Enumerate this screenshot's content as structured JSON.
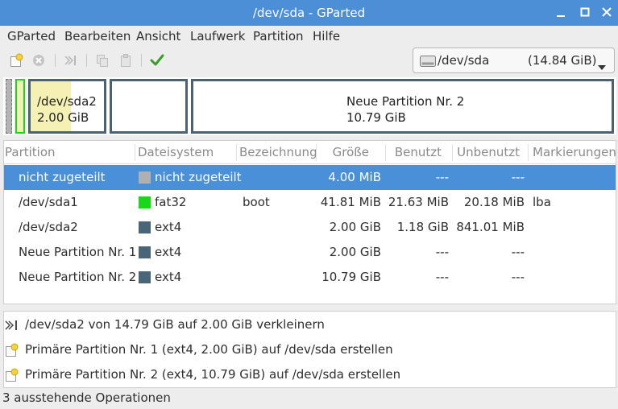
{
  "window": {
    "title": "/dev/sda - GParted"
  },
  "menu": [
    "GParted",
    "Bearbeiten",
    "Ansicht",
    "Laufwerk",
    "Partition",
    "Hilfe"
  ],
  "toolbar": {
    "icons": [
      "new-partition-icon",
      "delete-icon",
      "resize-move-icon",
      "copy-icon",
      "paste-icon",
      "apply-icon"
    ]
  },
  "device": {
    "name": "/dev/sda",
    "size": "(14.84 GiB)"
  },
  "graph": {
    "segments": [
      {
        "name": "/dev/sda2",
        "size": "2.00 GiB"
      },
      {
        "name": "Neue Partition Nr. 2",
        "size": "10.79 GiB"
      }
    ]
  },
  "table": {
    "headers": [
      "Partition",
      "Dateisystem",
      "Bezeichnung",
      "Größe",
      "Benutzt",
      "Unbenutzt",
      "Markierungen"
    ],
    "rows": [
      {
        "partition": "nicht zugeteilt",
        "fs": "nicht zugeteilt",
        "fs_color": "#b0b0b0",
        "label": "",
        "size": "4.00 MiB",
        "used": "---",
        "unused": "---",
        "flags": "",
        "selected": true
      },
      {
        "partition": "/dev/sda1",
        "fs": "fat32",
        "fs_color": "#18d918",
        "label": "boot",
        "size": "41.81 MiB",
        "used": "21.63 MiB",
        "unused": "20.18 MiB",
        "flags": "lba",
        "selected": false
      },
      {
        "partition": "/dev/sda2",
        "fs": "ext4",
        "fs_color": "#4a6478",
        "label": "",
        "size": "2.00 GiB",
        "used": "1.18 GiB",
        "unused": "841.01 MiB",
        "flags": "",
        "selected": false
      },
      {
        "partition": "Neue Partition Nr. 1",
        "fs": "ext4",
        "fs_color": "#4a6478",
        "label": "",
        "size": "2.00 GiB",
        "used": "---",
        "unused": "---",
        "flags": "",
        "selected": false
      },
      {
        "partition": "Neue Partition Nr. 2",
        "fs": "ext4",
        "fs_color": "#4a6478",
        "label": "",
        "size": "10.79 GiB",
        "used": "---",
        "unused": "---",
        "flags": "",
        "selected": false
      }
    ]
  },
  "operations": [
    {
      "icon": "resize-icon",
      "text": "/dev/sda2 von 14.79 GiB auf 2.00 GiB verkleinern"
    },
    {
      "icon": "new-partition-icon",
      "text": "Primäre Partition Nr. 1 (ext4, 2.00 GiB) auf /dev/sda erstellen"
    },
    {
      "icon": "new-partition-icon",
      "text": "Primäre Partition Nr. 2 (ext4, 10.79 GiB) auf /dev/sda erstellen"
    }
  ],
  "status": "3 ausstehende Operationen",
  "colors": {
    "titlebar": "#4d8fd6",
    "selection": "#4a90d9",
    "partition_frame": "#4c6272",
    "used_space": "#f5f0b4"
  }
}
